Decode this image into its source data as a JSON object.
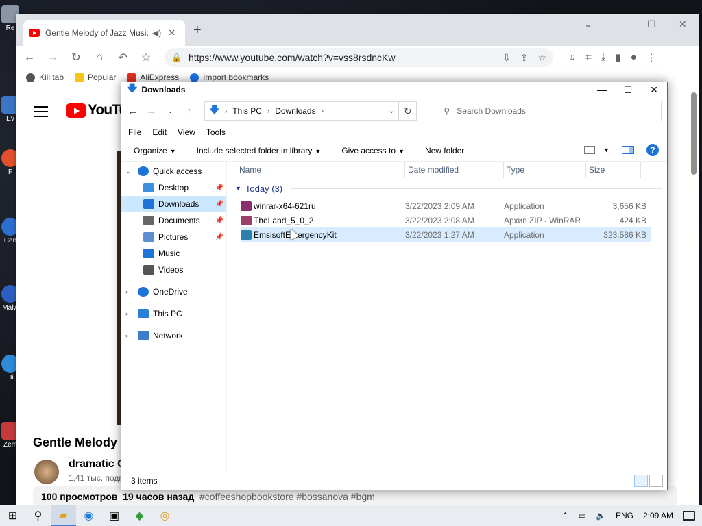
{
  "browser": {
    "tab_title": "Gentle Melody of Jazz Music in",
    "url": "https://www.youtube.com/watch?v=vss8rsdncKw",
    "bookmarks": [
      "Kill tab",
      "Popular",
      "AliExpress",
      "Import bookmarks"
    ]
  },
  "youtube": {
    "logo_text": "YouTub",
    "video_title": "Gentle Melody",
    "channel": "dramatic C",
    "subs": "1,41 тыс. подп",
    "views": "100 просмотров",
    "ago": "19 часов назад",
    "tags": "#coffeeshopbookstore #bossanova #bgm"
  },
  "explorer": {
    "title": "Downloads",
    "breadcrumb": [
      "This PC",
      "Downloads"
    ],
    "search_placeholder": "Search Downloads",
    "menu": [
      "File",
      "Edit",
      "View",
      "Tools"
    ],
    "commands": [
      "Organize",
      "Include selected folder in library",
      "Give access to",
      "New folder"
    ],
    "nav": [
      {
        "label": "Quick access",
        "type": "root"
      },
      {
        "label": "Desktop",
        "type": "child",
        "pinned": true
      },
      {
        "label": "Downloads",
        "type": "child",
        "pinned": true,
        "selected": true
      },
      {
        "label": "Documents",
        "type": "child",
        "pinned": true
      },
      {
        "label": "Pictures",
        "type": "child",
        "pinned": true
      },
      {
        "label": "Music",
        "type": "child"
      },
      {
        "label": "Videos",
        "type": "child"
      },
      {
        "label": "OneDrive",
        "type": "root"
      },
      {
        "label": "This PC",
        "type": "root"
      },
      {
        "label": "Network",
        "type": "root"
      }
    ],
    "columns": [
      "Name",
      "Date modified",
      "Type",
      "Size"
    ],
    "group_label": "Today (3)",
    "files": [
      {
        "name": "winrar-x64-621ru",
        "date": "3/22/2023 2:09 AM",
        "type": "Application",
        "size": "3,656 KB"
      },
      {
        "name": "TheLand_5_0_2",
        "date": "3/22/2023 2:08 AM",
        "type": "Архив ZIP - WinRAR",
        "size": "424 KB"
      },
      {
        "name": "EmsisoftEmergencyKit",
        "date": "3/22/2023 1:27 AM",
        "type": "Application",
        "size": "323,586 KB"
      }
    ],
    "status": "3 items"
  },
  "desktop_icons": [
    "Re",
    "Ev",
    "F",
    "Cen",
    "Malw",
    "Hi",
    "Zem"
  ],
  "taskbar": {
    "language": "ENG",
    "time": "2:09 AM"
  },
  "colors": {
    "accent": "#1e73d6",
    "selection": "#cce8ff",
    "youtube_red": "#ff0000"
  }
}
